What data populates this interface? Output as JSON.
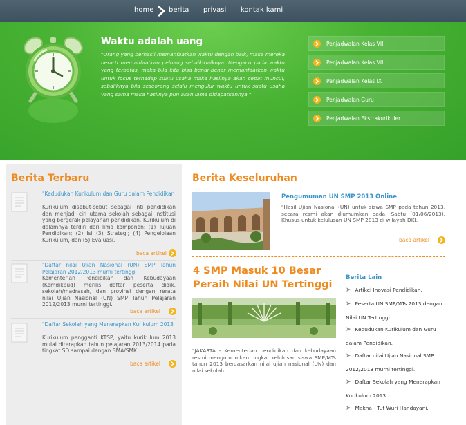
{
  "nav": {
    "items": [
      "home",
      "berita",
      "privasi",
      "kontak kami"
    ]
  },
  "hero": {
    "title": "Waktu adalah uang",
    "quote": "\"Orang yang berhasil memanfaatkan waktu dengan baik, maka mereka berarti memanfaatkan peluang sebaik-baiknya. Mengacu pada waktu yang terbatas, maka bila kita bisa benar-benar memanfaatkan waktu untuk focus terhadap suatu usaha maka hasilnya akan cepat muncul, sebaliknya bila seseorang selalu mengulur waktu untuk suatu usaha yang sama maka hasilnya pun akan lama didapatkannya.\""
  },
  "schedule": {
    "items": [
      "Penjadwalan Kelas VII",
      "Penjadwalan Kelas VIII",
      "Penjadwalan Kelas IX",
      "Penjadwalan Guru",
      "Penjadwalan Ekstrakurikuler"
    ]
  },
  "berita_terbaru": {
    "heading": "Berita Terbaru",
    "items": [
      {
        "title": "\"Kedudukan Kurikulum dan Guru dalam Pendidikan",
        "body": "Kurikulum disebut-sebut sebagai inti pendidikan dan menjadi ciri utama sekolah sebagai institusi yang bergerak pelayanan pendidikan. Kurikulum di dalamnya terdiri dari lima komponen: (1) Tujuan Pendidikan; (2) Isi (3) Strategi; (4) Pengelolaan Kurikulum, dan (5) Evaluasi.",
        "more": "baca artikel"
      },
      {
        "title": "\"Daftar nilai Ujian Nasional (UN) SMP Tahun Pelajaran 2012/2013 murni tertinggi",
        "body": "Kementerian Pendidikan dan Kebudayaan (Kemdikbud) merilis daftar peserta didik, sekolah/madrasah, dan provinsi dengan rerata nilai Ujian Nasional (UN) SMP Tahun Pelajaran 2012/2013 murni tertinggi.",
        "more": "baca artikel"
      },
      {
        "title": "\"Daftar Sekolah yang Menerapkan Kurikulum 2013",
        "body": "Kurikulum pengganti KTSP, yaitu kurikulum 2013 mulai diterapkan tahun pelajaran 2013/2014 pada tingkat SD sampai dengan SMA/SMK.",
        "more": "baca artikel"
      }
    ]
  },
  "berita_keseluruhan": {
    "heading": "Berita Keseluruhan",
    "feature": {
      "title": "Pengumuman UN SMP 2013 Online",
      "body": "\"Hasil Ujian Nasional (UN) untuk siswa SMP pada tahun 2013, secara resmi akan diumumkan pada, Sabtu (01/06/2013). Khusus untuk kelulusan UN SMP 2013 di wilayah DKI.",
      "more": "baca artikel"
    },
    "second": {
      "title": "4 SMP Masuk 10 Besar Peraih Nilai UN Tertinggi",
      "body": "\"JAKARTA - Kementerian pendidikan dan kebudayaan resmi mengumumkan tingkat kelulusan siswa SMP/MTs tahun 2013 berdasarkan nilai ujian nasional (UN) dan nilai sekolah."
    }
  },
  "berita_lain": {
    "heading": "Berita Lain",
    "items": [
      "Artikel Inovasi Pendidikan.",
      "Peserta UN SMP/MTs 2013 dengan Nilai UN Tertinggi.",
      "Kedudukan Kurikulum dan Guru dalam Pendidikan.",
      "Daftar nilai Ujian Nasional SMP 2012/2013 murni tertinggi.",
      "Daftar Sekolah yang Menerapkan Kurikulum 2013.",
      "Makna - Tut Wuri Handayani."
    ]
  },
  "colors": {
    "nav_bg": "#45596a",
    "hero_green": "#48b233",
    "accent_orange": "#ef8a1e",
    "link_blue": "#3a95c9"
  }
}
